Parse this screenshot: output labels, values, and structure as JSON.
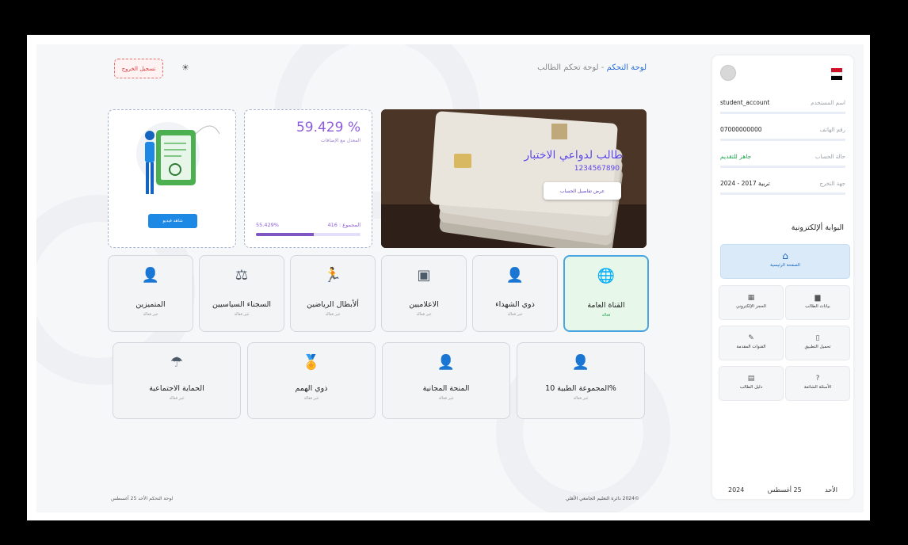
{
  "header": {
    "title_main": "لوحة التحكم",
    "title_sep": " - ",
    "title_sub": "لوحة تحكم الطالب",
    "logout_label": "تسجيل الخروج",
    "theme_icon": "sun-icon"
  },
  "sidebar": {
    "rows": [
      {
        "label": "اسم المستخدم",
        "value": "student_account"
      },
      {
        "label": "رقم الهاتف",
        "value": "07000000000"
      },
      {
        "label": "حالة الحساب",
        "value": "جاهز للتقديم"
      },
      {
        "label": "جهة التخرج",
        "value": "تربية 2017 - 2024"
      }
    ],
    "portal_title": "البوابة ألإلكترونية",
    "home_label": "الصفحة الرئيسية",
    "tiles": [
      {
        "label": "بيانات الطالب",
        "icon": "id-card-icon",
        "glyph": "▆"
      },
      {
        "label": "الحجز الإلكتروني",
        "icon": "calendar-icon",
        "glyph": "▦"
      },
      {
        "label": "تحميل التطبيق",
        "icon": "phone-icon",
        "glyph": "▯"
      },
      {
        "label": "القنوات المقدمة",
        "icon": "edit-icon",
        "glyph": "✎"
      },
      {
        "label": "الأسئلة الشائعة",
        "icon": "question-icon",
        "glyph": "?"
      },
      {
        "label": "دليل الطالب",
        "icon": "book-icon",
        "glyph": "▤"
      }
    ],
    "date_day": "الأحد",
    "date_daymonth": "25 أغسطس",
    "date_year": "2024"
  },
  "cards": {
    "illus_btn": "شاهد فيديو",
    "rate_value": "59.429 %",
    "rate_caption": "المعدل مع الإضافات",
    "total_label": "المجموع : 416",
    "total_percent": "55.429%",
    "total_fill": 0.55,
    "photo_title": "طالب لدواعي الاختبار",
    "photo_number": "1234567890",
    "photo_btn": "عرض تفاصيل الحساب"
  },
  "categories_row1": [
    {
      "title": "القناة العامة",
      "status": "فعالة",
      "icon": "globe-icon",
      "glyph": "🌐",
      "active": true
    },
    {
      "title": "ذوي الشهداء",
      "status": "غير فعالة",
      "icon": "user-shield-icon",
      "glyph": "👤"
    },
    {
      "title": "الاعلاميين",
      "status": "غير فعالة",
      "icon": "camera-icon",
      "glyph": "▣"
    },
    {
      "title": "ألأبطال الرياضين",
      "status": "غير فعالة",
      "icon": "runner-icon",
      "glyph": "🏃"
    },
    {
      "title": "السجناء السياسيين",
      "status": "غير فعالة",
      "icon": "scales-icon",
      "glyph": "⚖"
    },
    {
      "title": "المتميزين",
      "status": "غير فعالة",
      "icon": "user-check-icon",
      "glyph": "👤"
    }
  ],
  "categories_row2": [
    {
      "title": "%المجموعة الطبية 10",
      "status": "غير فعالة",
      "icon": "doctor-icon",
      "glyph": "👤"
    },
    {
      "title": "المنحة المجانية",
      "status": "غير فعالة",
      "icon": "doctor-icon",
      "glyph": "👤"
    },
    {
      "title": "ذوي الهمم",
      "status": "غير فعالة",
      "icon": "medal-icon",
      "glyph": "🏅"
    },
    {
      "title": "الحماية الاجتماعية",
      "status": "غير فعالة",
      "icon": "umbrella-icon",
      "glyph": "☂"
    }
  ],
  "footer": {
    "left": "لوحة التحكم   الأحد   25 أغسطس",
    "right": "©2024  دائرة التعليم الجامعي الأهلي"
  },
  "colors": {
    "accent": "#2b6ed6",
    "purple": "#8e5cd9",
    "active_bg": "#e7f8ea",
    "danger": "#e0393e"
  }
}
